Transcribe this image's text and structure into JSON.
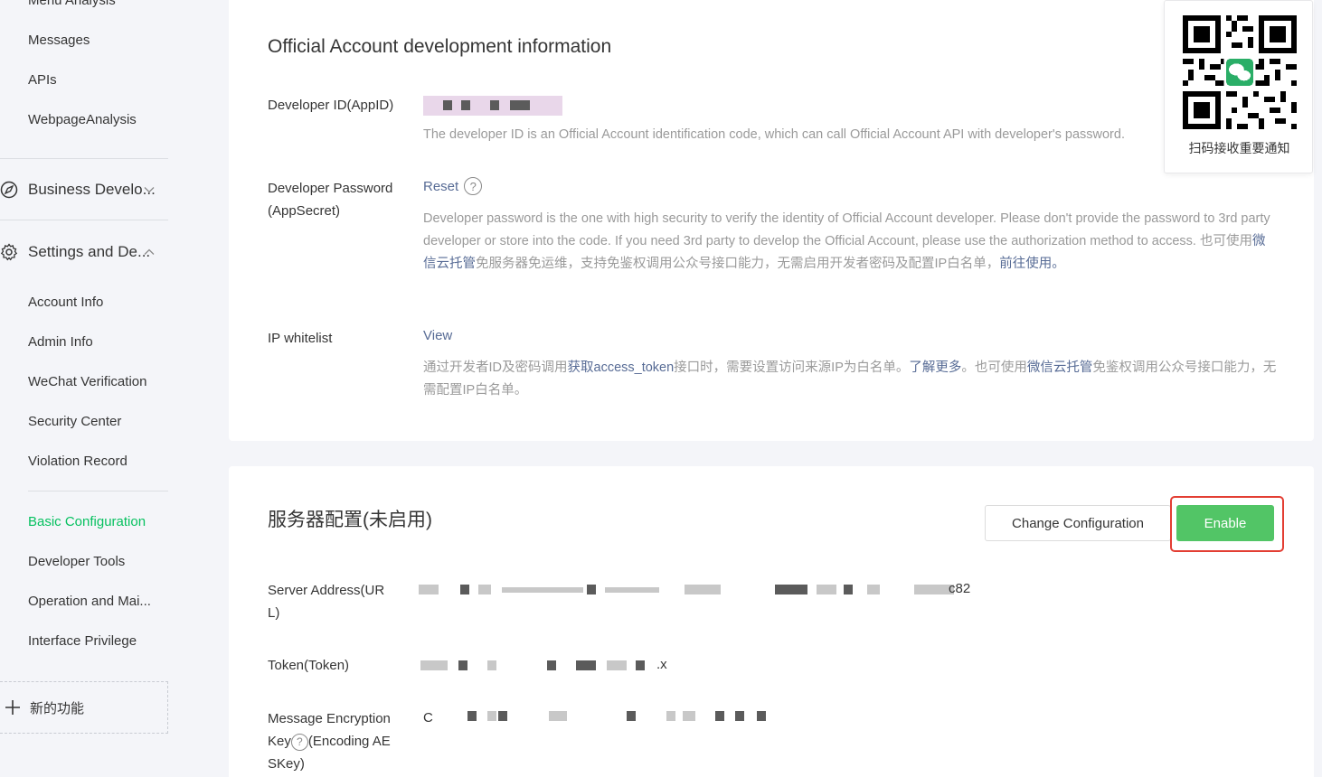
{
  "sidebar": {
    "top_items": [
      "Menu Analysis",
      "Messages",
      "APIs",
      "WebpageAnalysis"
    ],
    "sections": [
      {
        "label": "Business Develo...",
        "icon": "compass-icon",
        "chevron": "chevron-down-icon"
      },
      {
        "label": "Settings and De...",
        "icon": "gear-icon",
        "chevron": "chevron-up-icon"
      }
    ],
    "settings_items": [
      "Account Info",
      "Admin Info",
      "WeChat Verification",
      "Security Center",
      "Violation Record"
    ],
    "config_items": [
      "Basic Configuration",
      "Developer Tools",
      "Operation and Mai...",
      "Interface Privilege"
    ],
    "active_item": "Basic Configuration",
    "new_feature_label": "新的功能"
  },
  "dev_info": {
    "title": "Official Account development information",
    "developer_id": {
      "label": "Developer ID(AppID)",
      "description": "The developer ID is an Official Account identification code, which can call Official Account API with developer's password."
    },
    "developer_password": {
      "label": "Developer Password(AppSecret)",
      "action": "Reset",
      "description_en": "Developer password is the one with high security to verify the identity of Official Account developer. Please don't provide the password to 3rd party developer or store into the code. If you need 3rd party to develop the Official Account, please use the authorization method to access. ",
      "description_cn_1": "也可使用",
      "cloud_link": "微信云托管",
      "description_cn_2": "免服务器免运维，支持免鉴权调用公众号接口能力，无需启用开发者密码及配置IP白名单，",
      "goto_link": "前往使用",
      "end_mark": "。"
    },
    "ip_whitelist": {
      "label": "IP whitelist",
      "action": "View",
      "desc_1": "通过开发者ID及密码调用",
      "token_link": "获取access_token",
      "desc_2": "接口时，需要设置访问来源IP为白名单。",
      "learn_more": "了解更多",
      "desc_3": "。也可使用",
      "cloud_link": "微信云托管",
      "desc_4": "免鉴权调用公众号接口能力，无需配置IP白名单。"
    }
  },
  "server_config": {
    "title": "服务器配置(未启用)",
    "change_button": "Change Configuration",
    "enable_button": "Enable",
    "server_address": {
      "label": "Server Address(URL)",
      "value_tail": "c82"
    },
    "token": {
      "label": "Token(Token)",
      "value_tail": ".x"
    },
    "aes_key": {
      "label_1": "Message Encryption Key",
      "label_2": "(Encoding AESKey)",
      "value_head": "C"
    }
  },
  "qr_panel": {
    "caption": "扫码接收重要通知",
    "icon": "wechat-icon"
  },
  "colors": {
    "accent": "#07c160",
    "button_green": "#52c566",
    "link": "#576b95",
    "highlight": "#e33e33"
  }
}
